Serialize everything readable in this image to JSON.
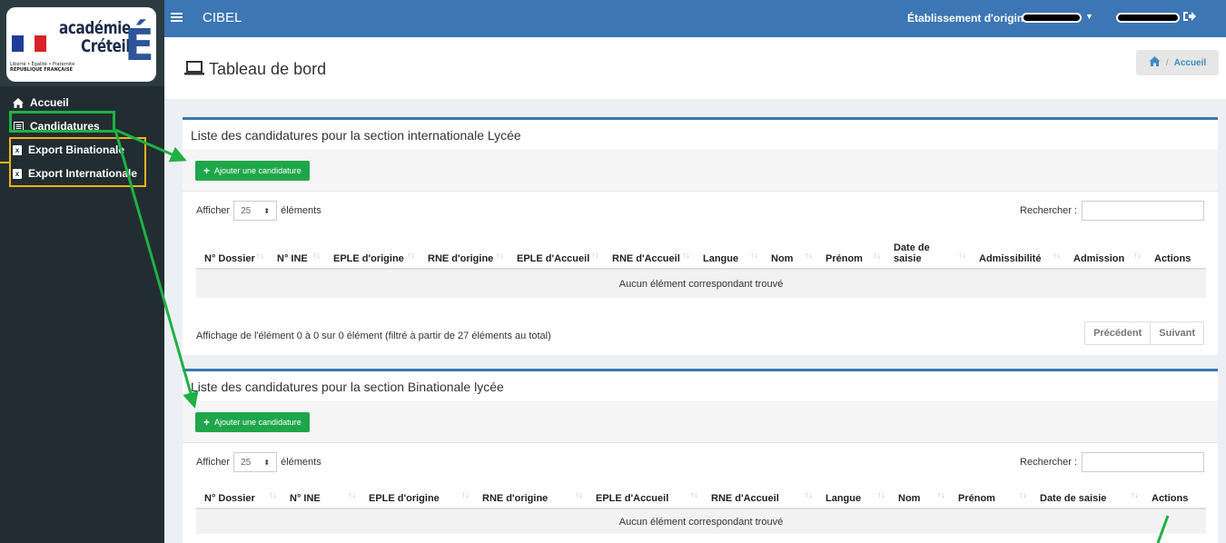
{
  "topbar": {
    "brand": "CIBEL",
    "etablissement_label": "Établissement d'origine :"
  },
  "logo": {
    "line1": "académie",
    "line2": "Créteil",
    "letter": "É",
    "rf_motto": "Liberté • Égalité • Fraternité",
    "rf_name": "RÉPUBLIQUE FRANÇAISE"
  },
  "sidebar": {
    "items": [
      {
        "label": "Accueil",
        "icon": "home-icon"
      },
      {
        "label": "Candidatures",
        "icon": "list-icon"
      },
      {
        "label": "Export Binationale",
        "icon": "excel-icon"
      },
      {
        "label": "Export Internationale",
        "icon": "excel-icon"
      }
    ]
  },
  "header": {
    "title": "Tableau de bord",
    "breadcrumb": "Accueil"
  },
  "panel1": {
    "title": "Liste des candidatures pour la section internationale Lycée",
    "add_button": "Ajouter une candidature",
    "show_label": "Afficher",
    "page_size": "25",
    "elements_label": "éléments",
    "search_label": "Rechercher :",
    "columns": [
      "N° Dossier",
      "N° INE",
      "EPLE d'origine",
      "RNE d'origine",
      "EPLE d'Accueil",
      "RNE d'Accueil",
      "Langue",
      "Nom",
      "Prénom",
      "Date de saisie",
      "Admissibilité",
      "Admission",
      "Actions"
    ],
    "empty_text": "Aucun élément correspondant trouvé",
    "info": "Affichage de l'élément 0 à 0 sur 0 élément (filtré à partir de 27 éléments au total)",
    "prev": "Précédent",
    "next": "Suivant"
  },
  "panel2": {
    "title": "Liste des candidatures pour la section Binationale lycée",
    "add_button": "Ajouter une candidature",
    "show_label": "Afficher",
    "page_size": "25",
    "elements_label": "éléments",
    "search_label": "Rechercher :",
    "columns": [
      "N° Dossier",
      "N° INE",
      "EPLE d'origine",
      "RNE d'origine",
      "EPLE d'Accueil",
      "RNE d'Accueil",
      "Langue",
      "Nom",
      "Prénom",
      "Date de saisie",
      "Actions"
    ],
    "empty_text": "Aucun élément correspondant trouvé"
  },
  "colors": {
    "topbar": "#3c76b4",
    "sidebar": "#222d32",
    "add_button": "#1fa64a",
    "annotation_green": "#1fb144",
    "annotation_yellow": "#f2b21a"
  }
}
